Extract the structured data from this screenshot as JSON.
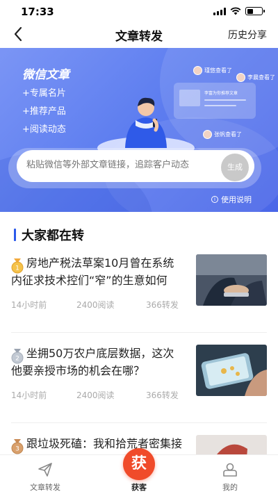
{
  "status": {
    "time": "17:33"
  },
  "nav": {
    "title": "文章转发",
    "right_label": "历史分享"
  },
  "banner": {
    "feature_title": "微信文章",
    "features": [
      "+专属名片",
      "+推荐产品",
      "+阅读动态"
    ],
    "card_mock_text": "李富为你推荐文章",
    "viewers": [
      "瑾悠查看了",
      "李晨查看了",
      "张帆查看了"
    ],
    "input_placeholder": "粘贴微信等外部文章链接，追踪客户动态",
    "generate_label": "生成",
    "usage_label": "使用说明"
  },
  "section": {
    "title": "大家都在转"
  },
  "articles": [
    {
      "title": "房地产税法草案10月曾在系统内征求技术控们“窄”的生意如何",
      "time": "14小时前",
      "reads": "2400阅读",
      "shares": "366转发",
      "medal": "gold"
    },
    {
      "title": "坐拥50万农户底层数据，这次他要亲授市场的机会在哪？",
      "time": "14小时前",
      "reads": "2400阅读",
      "shares": "366转发",
      "medal": "silver"
    },
    {
      "title": "跟垃圾死磕：我和拾荒者密集接触的这些年",
      "time": "",
      "reads": "",
      "shares": "",
      "medal": "bronze"
    }
  ],
  "tabs": {
    "left": "文章转发",
    "center": "获客",
    "center_icon_text": "获",
    "right": "我的"
  },
  "colors": {
    "accent": "#2b59ea",
    "brand_red": "#f04b2a",
    "banner": "#5f7ff0"
  }
}
